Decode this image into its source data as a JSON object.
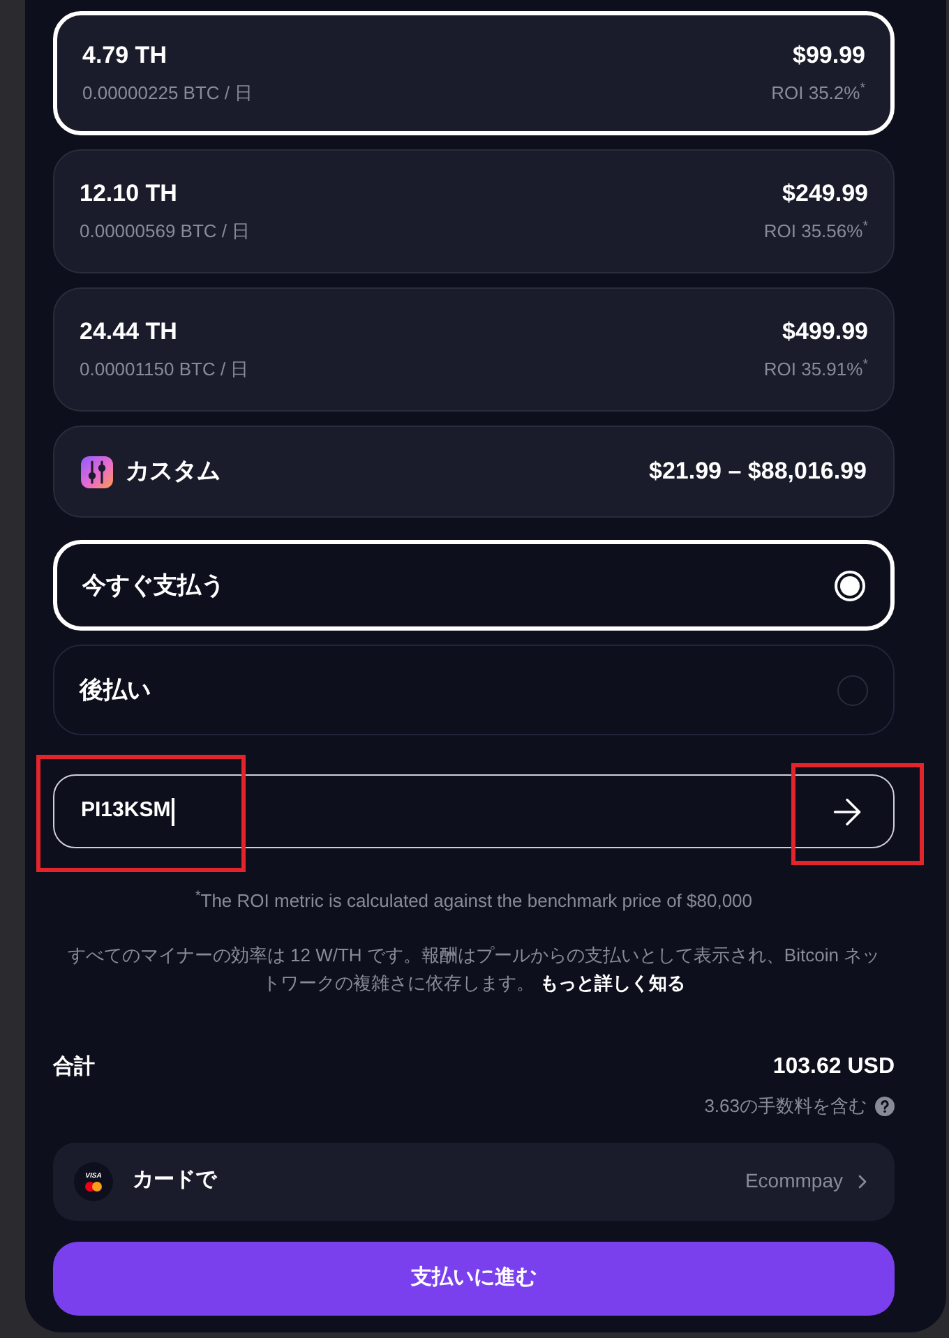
{
  "plans": [
    {
      "hashrate": "4.79 TH",
      "yield": "0.00000225 BTC / 日",
      "price": "$99.99",
      "roi": "ROI 35.2%$^{*}$",
      "selected": true
    },
    {
      "hashrate": "12.10 TH",
      "yield": "0.00000569 BTC / 日",
      "price": "$249.99",
      "roi": "ROI 35.56%$^{*}$",
      "selected": false
    },
    {
      "hashrate": "24.44 TH",
      "yield": "0.00001150 BTC / 日",
      "price": "$499.99",
      "roi": "ROI 35.91%$^{*}$",
      "selected": false
    }
  ],
  "custom_plan": {
    "label": "カスタム",
    "price_range": "$21.99 – $88,016.99"
  },
  "payment_timing": [
    {
      "label": "今すぐ支払う",
      "selected": true
    },
    {
      "label": "後払い",
      "selected": false
    }
  ],
  "promo_code": {
    "value": "PI13KSM",
    "value_highlighted": true,
    "arrow_highlighted": true
  },
  "footnote": "$^{*}$The ROI metric is calculated against the benchmark price of $80,000",
  "disclaimer": {
    "text": "すべてのマイナーの効率は 12 W/TH です。報酬はプールからの支払いとして表示され、Bitcoin ネットワークの複雑さに依存します。",
    "link": "もっと詳しく知る"
  },
  "total": {
    "label": "合計",
    "amount": "103.62 USD",
    "fee_note": "3.63の手数料を含む"
  },
  "payment_method": {
    "logo_text": "VISA",
    "label": "カードで",
    "provider": "Ecommpay"
  },
  "submit_button": "支払いに進む"
}
